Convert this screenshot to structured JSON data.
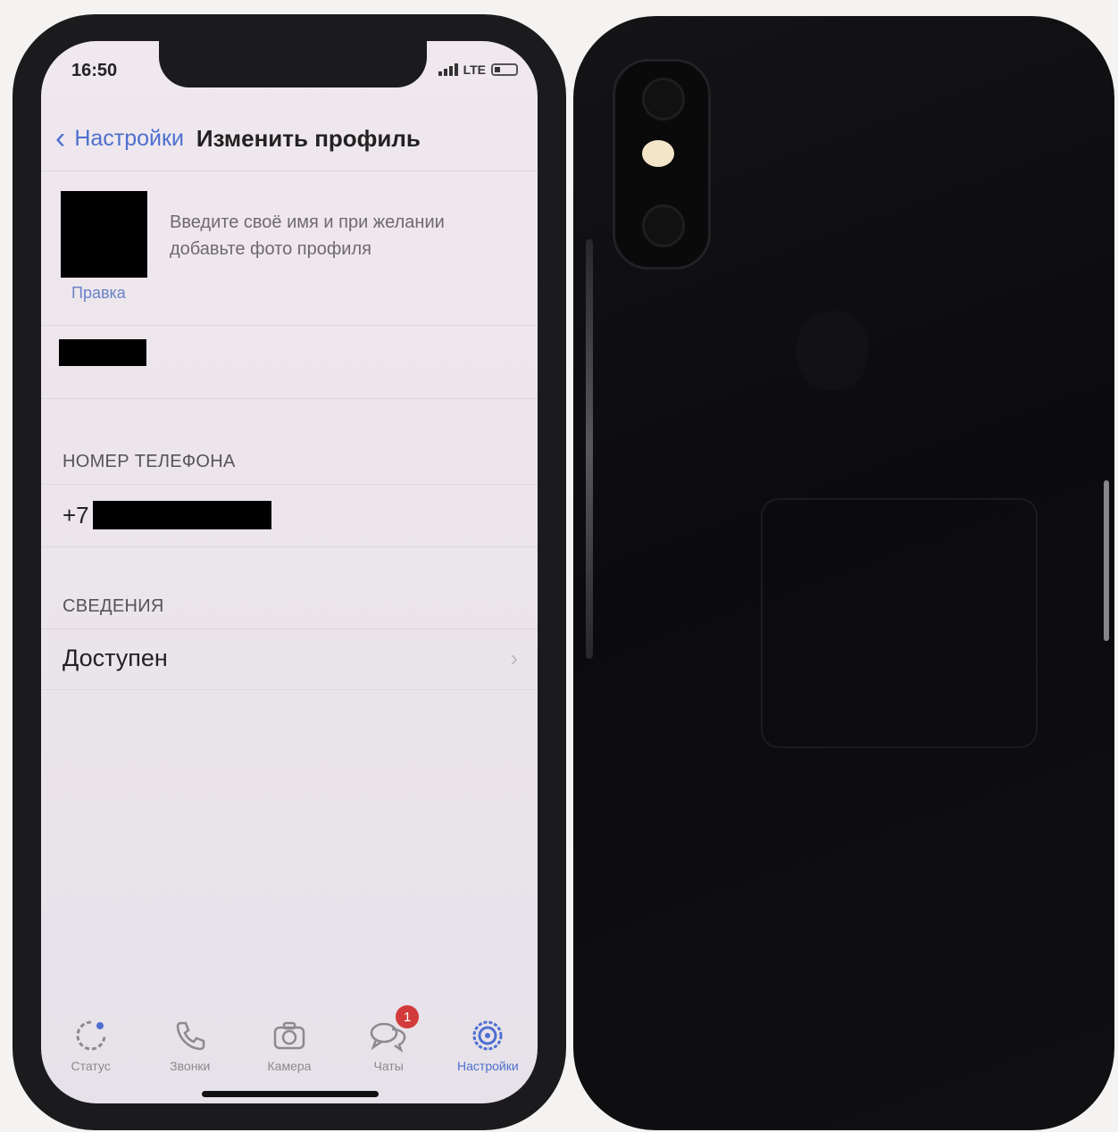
{
  "status_bar": {
    "time": "16:50",
    "network": "LTE"
  },
  "nav": {
    "back_label": "Настройки",
    "title": "Изменить профиль"
  },
  "profile": {
    "edit_label": "Правка",
    "hint": "Введите своё имя и при желании добавьте фото профиля"
  },
  "phone_section": {
    "header": "НОМЕР ТЕЛЕФОНА",
    "prefix": "+7"
  },
  "about_section": {
    "header": "СВЕДЕНИЯ",
    "value": "Доступен"
  },
  "tabbar": {
    "tabs": [
      {
        "label": "Статус",
        "icon": "status-icon"
      },
      {
        "label": "Звонки",
        "icon": "phone-icon"
      },
      {
        "label": "Камера",
        "icon": "camera-icon"
      },
      {
        "label": "Чаты",
        "icon": "chats-icon",
        "badge": "1"
      },
      {
        "label": "Настройки",
        "icon": "settings-icon",
        "active": true
      }
    ]
  },
  "colors": {
    "accent": "#4d6fd0",
    "badge": "#d23b3b",
    "phone_body": "#1b1b1d"
  }
}
